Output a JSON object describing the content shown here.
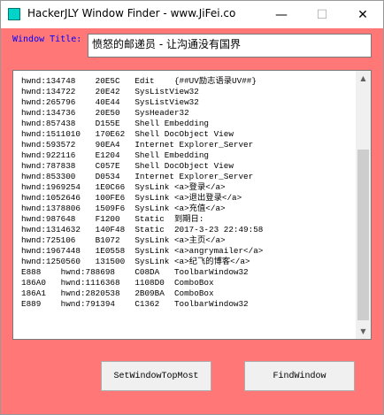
{
  "window": {
    "title": "HackerJLY Window Finder - www.JiFei.co",
    "min_glyph": "—",
    "max_glyph": "☐",
    "close_glyph": "✕"
  },
  "form": {
    "window_title_label": "Window Title:",
    "window_title_value": "愤怒的邮递员 - 让沟通没有国界"
  },
  "list": {
    "rows": [
      "hwnd:134748    20E5C   Edit    {##UV励志语录UV##}",
      "hwnd:134722    20E42   SysListView32",
      "hwnd:265796    40E44   SysListView32",
      "hwnd:134736    20E50   SysHeader32",
      "hwnd:857438    D155E   Shell Embedding",
      "hwnd:1511010   170E62  Shell DocObject View",
      "hwnd:593572    90EA4   Internet Explorer_Server",
      "hwnd:922116    E1204   Shell Embedding",
      "hwnd:787838    C057E   Shell DocObject View",
      "hwnd:853300    D0534   Internet Explorer_Server",
      "hwnd:1969254   1E0C66  SysLink <a>登录</a>",
      "hwnd:1052646   100FE6  SysLink <a>退出登录</a>",
      "hwnd:1378806   1509F6  SysLink <a>充值</a>",
      "hwnd:987648    F1200   Static  到期日:",
      "hwnd:1314632   140F48  Static  2017-3-23 22:49:58",
      "hwnd:725106    B1072   SysLink <a>主页</a>",
      "hwnd:1967448   1E0558  SysLink <a>angrymailer</a>",
      "hwnd:1250560   131500  SysLink <a>纪飞的博客</a>",
      "E888    hwnd:788698    C08DA   ToolbarWindow32",
      "186A0   hwnd:1116368   1108D0  ComboBox",
      "186A1   hwnd:2820538   2B09BA  ComboBox",
      "E889    hwnd:791394    C1362   ToolbarWindow32"
    ]
  },
  "scrollbar": {
    "up_glyph": "▲",
    "down_glyph": "▼"
  },
  "buttons": {
    "set_top_most": "SetWindowTopMost",
    "find_window": "FindWindow"
  },
  "colors": {
    "window_background": "#ff7777",
    "label_color": "#0000ff",
    "app_icon": "#00d4c8"
  }
}
